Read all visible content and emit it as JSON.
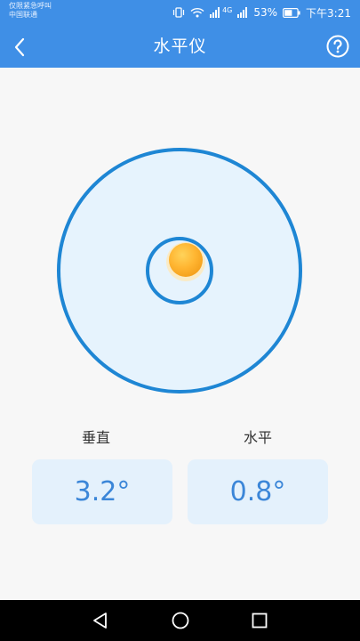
{
  "status_bar": {
    "carrier_line1": "仅限紧急呼叫",
    "carrier_line2": "中国联通",
    "signal_label": "4G",
    "battery": "53%",
    "time": "下午3:21"
  },
  "app_bar": {
    "title": "水平仪",
    "back_icon": "chevron-left-icon",
    "help_icon": "question-circle-icon"
  },
  "level": {
    "bubble_color": "#ffb531",
    "ring_color": "#1e86d4",
    "fill_color": "#e6f3fd"
  },
  "readouts": {
    "vertical_label": "垂直",
    "vertical_value": "3.2°",
    "horizontal_label": "水平",
    "horizontal_value": "0.8°"
  },
  "nav_bar": {
    "back": "triangle-back-icon",
    "home": "circle-home-icon",
    "recents": "square-recents-icon"
  },
  "colors": {
    "primary": "#3f8fe6",
    "readout_text": "#3b86d8",
    "readout_bg": "#e4f1fc"
  }
}
